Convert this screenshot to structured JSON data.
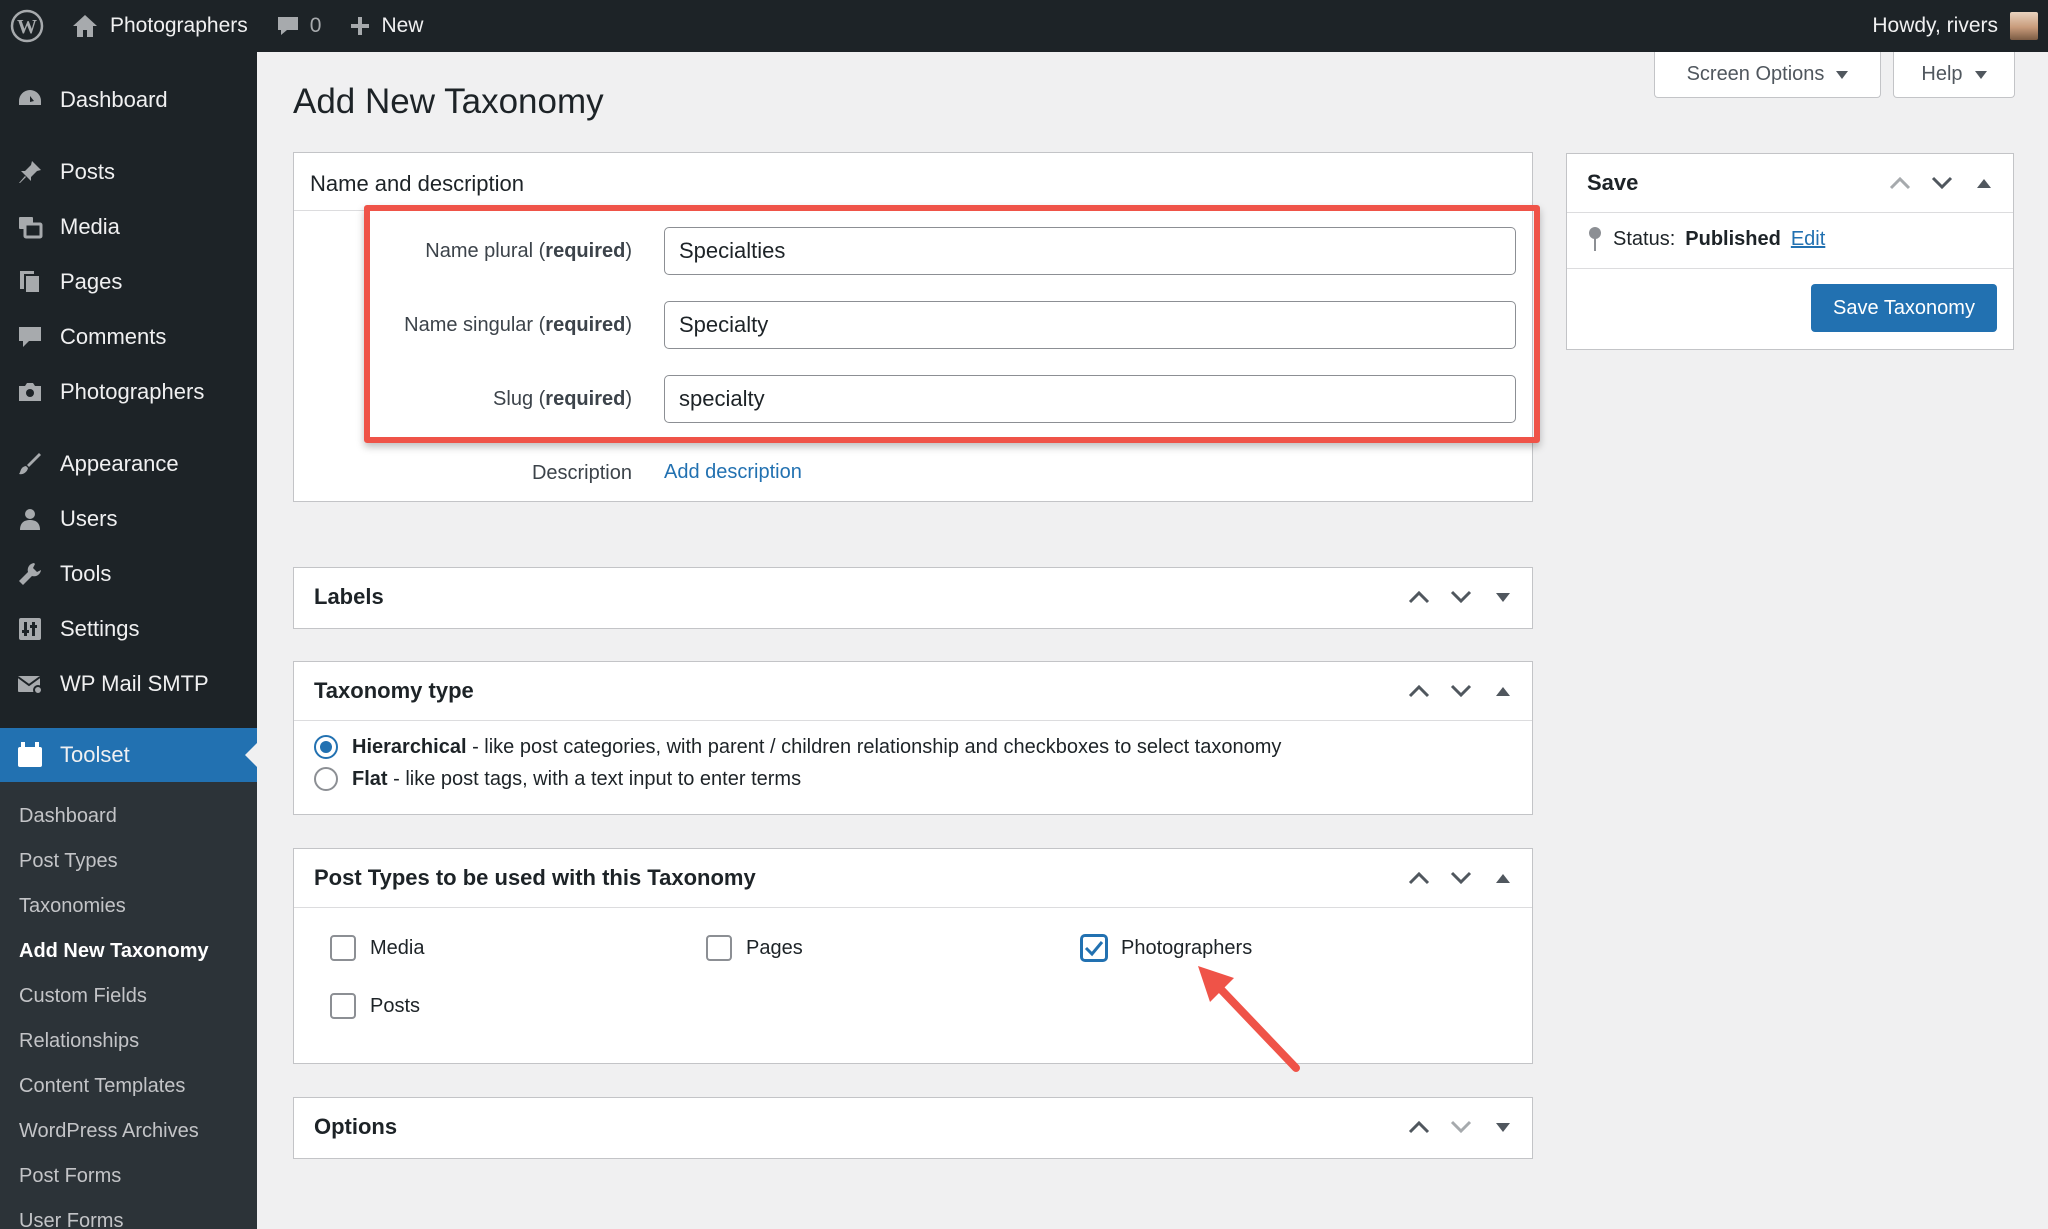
{
  "adminbar": {
    "site_name": "Photographers",
    "comments_count": "0",
    "new_label": "New",
    "greeting": "Howdy, rivers"
  },
  "sidebar": {
    "items": [
      {
        "label": "Dashboard",
        "icon": "dashboard-icon"
      },
      {
        "label": "Posts",
        "icon": "pin-icon"
      },
      {
        "label": "Media",
        "icon": "media-icon"
      },
      {
        "label": "Pages",
        "icon": "pages-icon"
      },
      {
        "label": "Comments",
        "icon": "comment-icon"
      },
      {
        "label": "Photographers",
        "icon": "camera-icon"
      },
      {
        "label": "Appearance",
        "icon": "brush-icon"
      },
      {
        "label": "Users",
        "icon": "user-icon"
      },
      {
        "label": "Tools",
        "icon": "wrench-icon"
      },
      {
        "label": "Settings",
        "icon": "settings-icon"
      },
      {
        "label": "WP Mail SMTP",
        "icon": "mail-icon"
      },
      {
        "label": "Toolset",
        "icon": "toolset-icon"
      }
    ],
    "submenu": [
      "Dashboard",
      "Post Types",
      "Taxonomies",
      "Add New Taxonomy",
      "Custom Fields",
      "Relationships",
      "Content Templates",
      "WordPress Archives",
      "Post Forms",
      "User Forms"
    ]
  },
  "screen_options": {
    "label": "Screen Options",
    "help_label": "Help"
  },
  "page_title": "Add New Taxonomy",
  "name_box": {
    "title": "Name and description",
    "required": "required",
    "fields": [
      {
        "label": "Name plural",
        "value": "Specialties"
      },
      {
        "label": "Name singular",
        "value": "Specialty"
      },
      {
        "label": "Slug",
        "value": "specialty"
      }
    ],
    "description_label": "Description",
    "description_link": "Add description"
  },
  "labels_box": {
    "title": "Labels"
  },
  "taxonomy_type": {
    "title": "Taxonomy type",
    "options": [
      {
        "name": "Hierarchical",
        "desc": " - like post categories, with parent / children relationship and checkboxes to select taxonomy",
        "selected": true
      },
      {
        "name": "Flat",
        "desc": " - like post tags, with a text input to enter terms",
        "selected": false
      }
    ]
  },
  "post_types": {
    "title": "Post Types to be used with this Taxonomy",
    "options": [
      {
        "label": "Media",
        "checked": false
      },
      {
        "label": "Pages",
        "checked": false
      },
      {
        "label": "Photographers",
        "checked": true
      },
      {
        "label": "Posts",
        "checked": false
      }
    ]
  },
  "options_box": {
    "title": "Options"
  },
  "save_box": {
    "title": "Save",
    "status_label": "Status:",
    "status_value": "Published",
    "edit_link": "Edit",
    "button": "Save Taxonomy"
  },
  "colors": {
    "admin_dark": "#1d2327",
    "accent_blue": "#2271b1",
    "highlight_red": "#ef5348"
  }
}
